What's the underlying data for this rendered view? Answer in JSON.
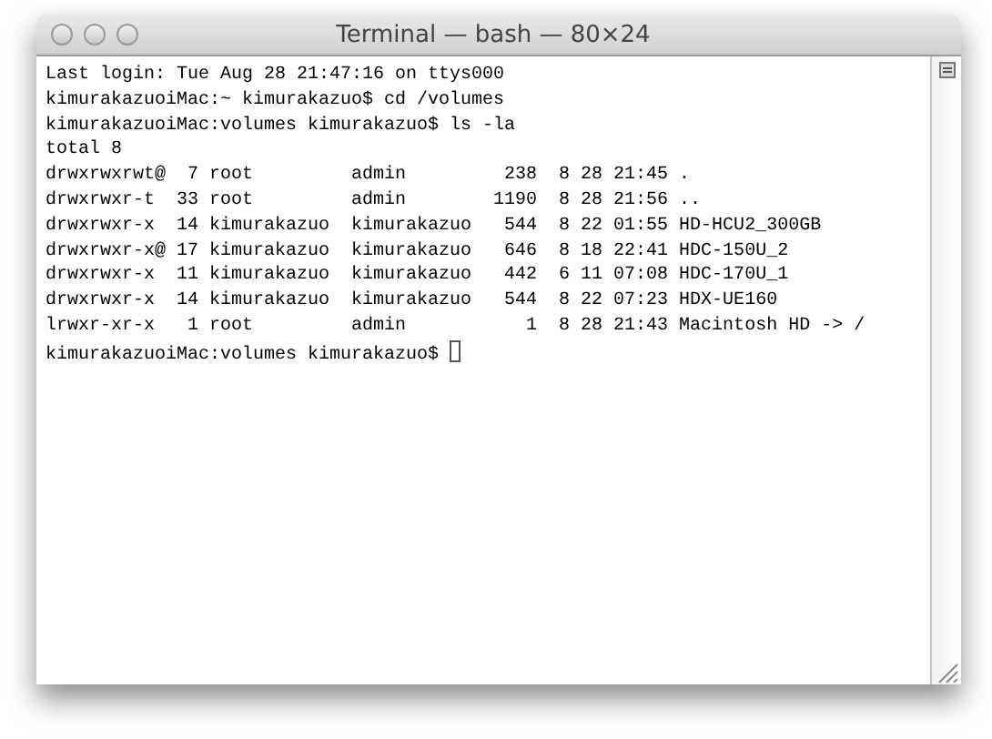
{
  "window": {
    "title": "Terminal — bash — 80×24"
  },
  "lines": [
    "Last login: Tue Aug 28 21:47:16 on ttys000",
    "kimurakazuoiMac:~ kimurakazuo$ cd /volumes",
    "kimurakazuoiMac:volumes kimurakazuo$ ls -la",
    "total 8",
    "drwxrwxrwt@  7 root         admin         238  8 28 21:45 .",
    "drwxrwxr-t  33 root         admin        1190  8 28 21:56 ..",
    "drwxrwxr-x  14 kimurakazuo  kimurakazuo   544  8 22 01:55 HD-HCU2_300GB",
    "drwxrwxr-x@ 17 kimurakazuo  kimurakazuo   646  8 18 22:41 HDC-150U_2",
    "drwxrwxr-x  11 kimurakazuo  kimurakazuo   442  6 11 07:08 HDC-170U_1",
    "drwxrwxr-x  14 kimurakazuo  kimurakazuo   544  8 22 07:23 HDX-UE160",
    "lrwxr-xr-x   1 root         admin           1  8 28 21:43 Macintosh HD -> /",
    "kimurakazuoiMac:volumes kimurakazuo$ "
  ],
  "cursor": {
    "visible": true
  }
}
